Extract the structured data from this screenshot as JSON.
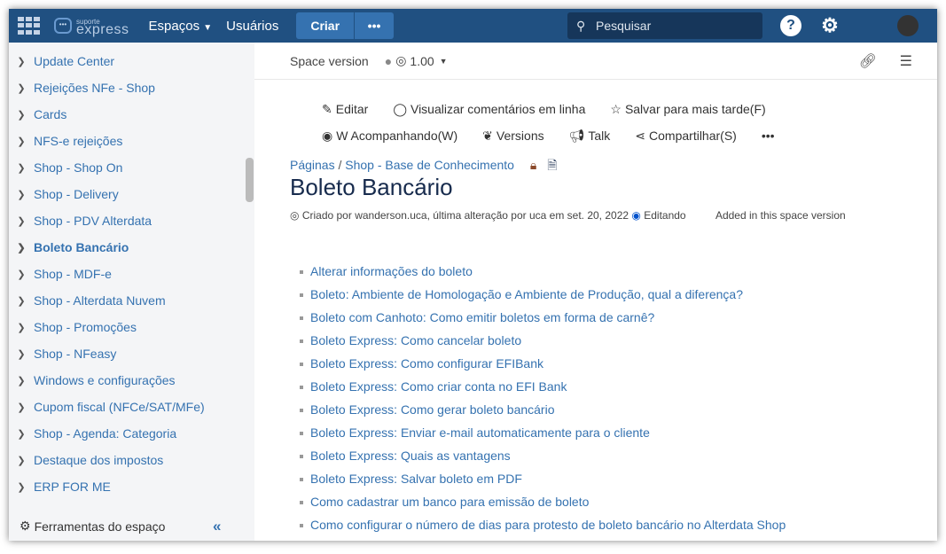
{
  "header": {
    "logo_small": "suporte",
    "logo_big": "express",
    "nav": [
      "Espaços",
      "Usuários"
    ],
    "create": "Criar",
    "more": "•••",
    "search_placeholder": "Pesquisar",
    "help": "?",
    "settings": "⚙"
  },
  "sidebar": {
    "items": [
      "Update Center",
      "Rejeições NFe - Shop",
      "Cards",
      "NFS-e rejeições",
      "Shop - Shop On",
      "Shop - Delivery",
      "Shop - PDV Alterdata",
      "Boleto Bancário",
      "Shop - MDF-e",
      "Shop - Alterdata Nuvem",
      "Shop - Promoções",
      "Shop - NFeasy",
      "Windows e configurações",
      "Cupom fiscal (NFCe/SAT/MFe)",
      "Shop - Agenda: Categoria",
      "Destaque dos impostos",
      "ERP FOR ME"
    ],
    "active": 7,
    "tools": "Ferramentas do espaço",
    "collapse": "«"
  },
  "version": {
    "label": "Space version",
    "value": "1.00"
  },
  "actions": {
    "edit": "Editar",
    "comments": "Visualizar comentários em linha",
    "save": "Salvar para mais tarde(F)",
    "watch": "W Acompanhando(W)",
    "versions": "Versions",
    "talk": "Talk",
    "share": "Compartilhar(S)",
    "more": "•••"
  },
  "breadcrumb": [
    "Páginas",
    "Shop - Base de Conhecimento"
  ],
  "page": {
    "title": "Boleto Bancário",
    "meta": "Criado por wanderson.uca, última alteração por uca em set. 20, 2022",
    "status": "Editando",
    "space_version": "Added in this space version"
  },
  "links": [
    "Alterar informações do boleto",
    "Boleto: Ambiente de Homologação e Ambiente de Produção, qual a diferença?",
    "Boleto com Canhoto: Como emitir boletos em forma de carnê?",
    "Boleto Express: Como cancelar boleto",
    "Boleto Express: Como configurar EFIBank",
    "Boleto Express: Como criar conta no EFI Bank",
    "Boleto Express: Como gerar boleto bancário",
    "Boleto Express: Enviar e-mail automaticamente para o cliente",
    "Boleto Express: Quais as vantagens",
    "Boleto Express: Salvar boleto em PDF",
    "Como cadastrar um banco para emissão de boleto",
    "Como configurar o número de dias para protesto de boleto bancário no Alterdata Shop"
  ]
}
